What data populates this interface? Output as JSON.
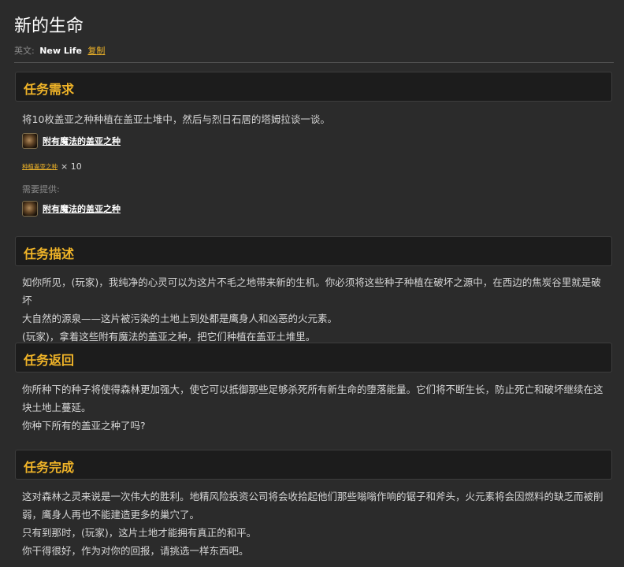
{
  "title": "新的生命",
  "english": {
    "label": "英文:",
    "name": "New Life",
    "copy_label": "复制"
  },
  "requirements": {
    "heading": "任务需求",
    "objective": "将10枚盖亚之种种植在盖亚土堆中，然后与烈日石居的塔姆拉谈一谈。",
    "item": {
      "name": "附有魔法的盖亚之种",
      "icon": "gaea-seed-icon"
    },
    "count_link": "种植盖亚之种",
    "count_text": "× 10",
    "provide_label": "需要提供:",
    "provided_item": {
      "name": "附有魔法的盖亚之种",
      "icon": "gaea-seed-icon"
    }
  },
  "description": {
    "heading": "任务描述",
    "lines": [
      "如你所见，(玩家)，我纯净的心灵可以为这片不毛之地带来新的生机。你必须将这些种子种植在破坏之源中，在西边的焦炭谷里就是破坏",
      "大自然的源泉——这片被污染的土地上到处都是鹰身人和凶恶的火元素。",
      "(玩家)，拿着这些附有魔法的盖亚之种，把它们种植在盖亚土堆里。"
    ]
  },
  "progress": {
    "heading": "任务返回",
    "lines": [
      "你所种下的种子将使得森林更加强大，使它可以抵御那些足够杀死所有新生命的堕落能量。它们将不断生长，防止死亡和破坏继续在这",
      "块土地上蔓延。",
      "你种下所有的盖亚之种了吗?"
    ]
  },
  "completion": {
    "heading": "任务完成",
    "lines": [
      "这对森林之灵来说是一次伟大的胜利。地精风险投资公司将会收拾起他们那些嗡嗡作响的锯子和斧头，火元素将会因燃料的缺乏而被削",
      "弱，鹰身人再也不能建造更多的巢穴了。",
      "只有到那时，(玩家)，这片土地才能拥有真正的和平。",
      "你干得很好，作为对你的回报，请挑选一样东西吧。"
    ]
  }
}
